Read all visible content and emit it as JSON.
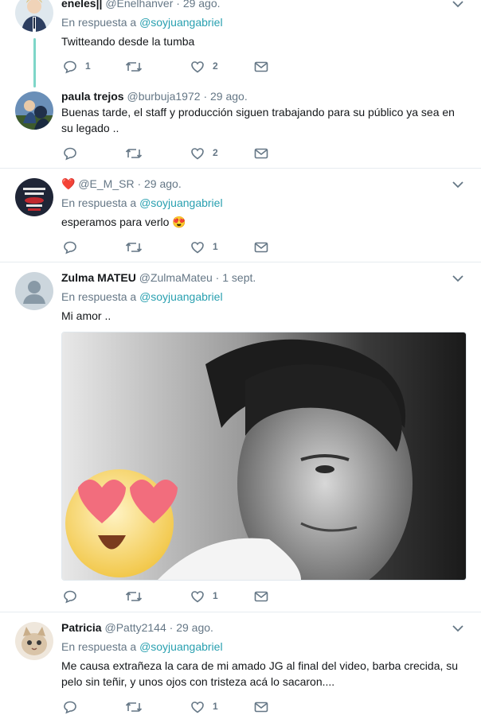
{
  "tweets": [
    {
      "name": "eneles||",
      "handle": "@Enelhanver",
      "time": "29 ago.",
      "reply_prefix": "En respuesta a",
      "reply_to": "@soyjuangabriel",
      "text": "Twitteando desde la tumba",
      "replies": "1",
      "retweets": "",
      "likes": "2"
    },
    {
      "name": "paula trejos",
      "handle": "@burbuja1972",
      "time": "29 ago.",
      "text": "Buenas tarde, el staff y producción siguen trabajando para su público ya sea en su legado ..",
      "replies": "",
      "retweets": "",
      "likes": "2"
    },
    {
      "name": "❤️",
      "handle": "@E_M_SR",
      "time": "29 ago.",
      "reply_prefix": "En respuesta a",
      "reply_to": "@soyjuangabriel",
      "text": "esperamos para verlo 😍",
      "replies": "",
      "retweets": "",
      "likes": "1"
    },
    {
      "name": "Zulma MATEU",
      "handle": "@ZulmaMateu",
      "time": "1 sept.",
      "reply_prefix": "En respuesta a",
      "reply_to": "@soyjuangabriel",
      "text": "Mi amor ..",
      "replies": "",
      "retweets": "",
      "likes": "1"
    },
    {
      "name": "Patricia",
      "handle": "@Patty2144",
      "time": "29 ago.",
      "reply_prefix": "En respuesta a",
      "reply_to": "@soyjuangabriel",
      "text": "Me causa extrañeza la cara de mi amado JG  al final del video, barba crecida, su pelo sin teñir, y unos ojos con tristeza acá lo sacaron....",
      "replies": "",
      "retweets": "",
      "likes": "1"
    }
  ],
  "dot": "·",
  "colors": {
    "mention": "#29a0b0",
    "thread_line": "#7ed6c8",
    "icon": "#657786",
    "separator": "#e6ecf0"
  }
}
